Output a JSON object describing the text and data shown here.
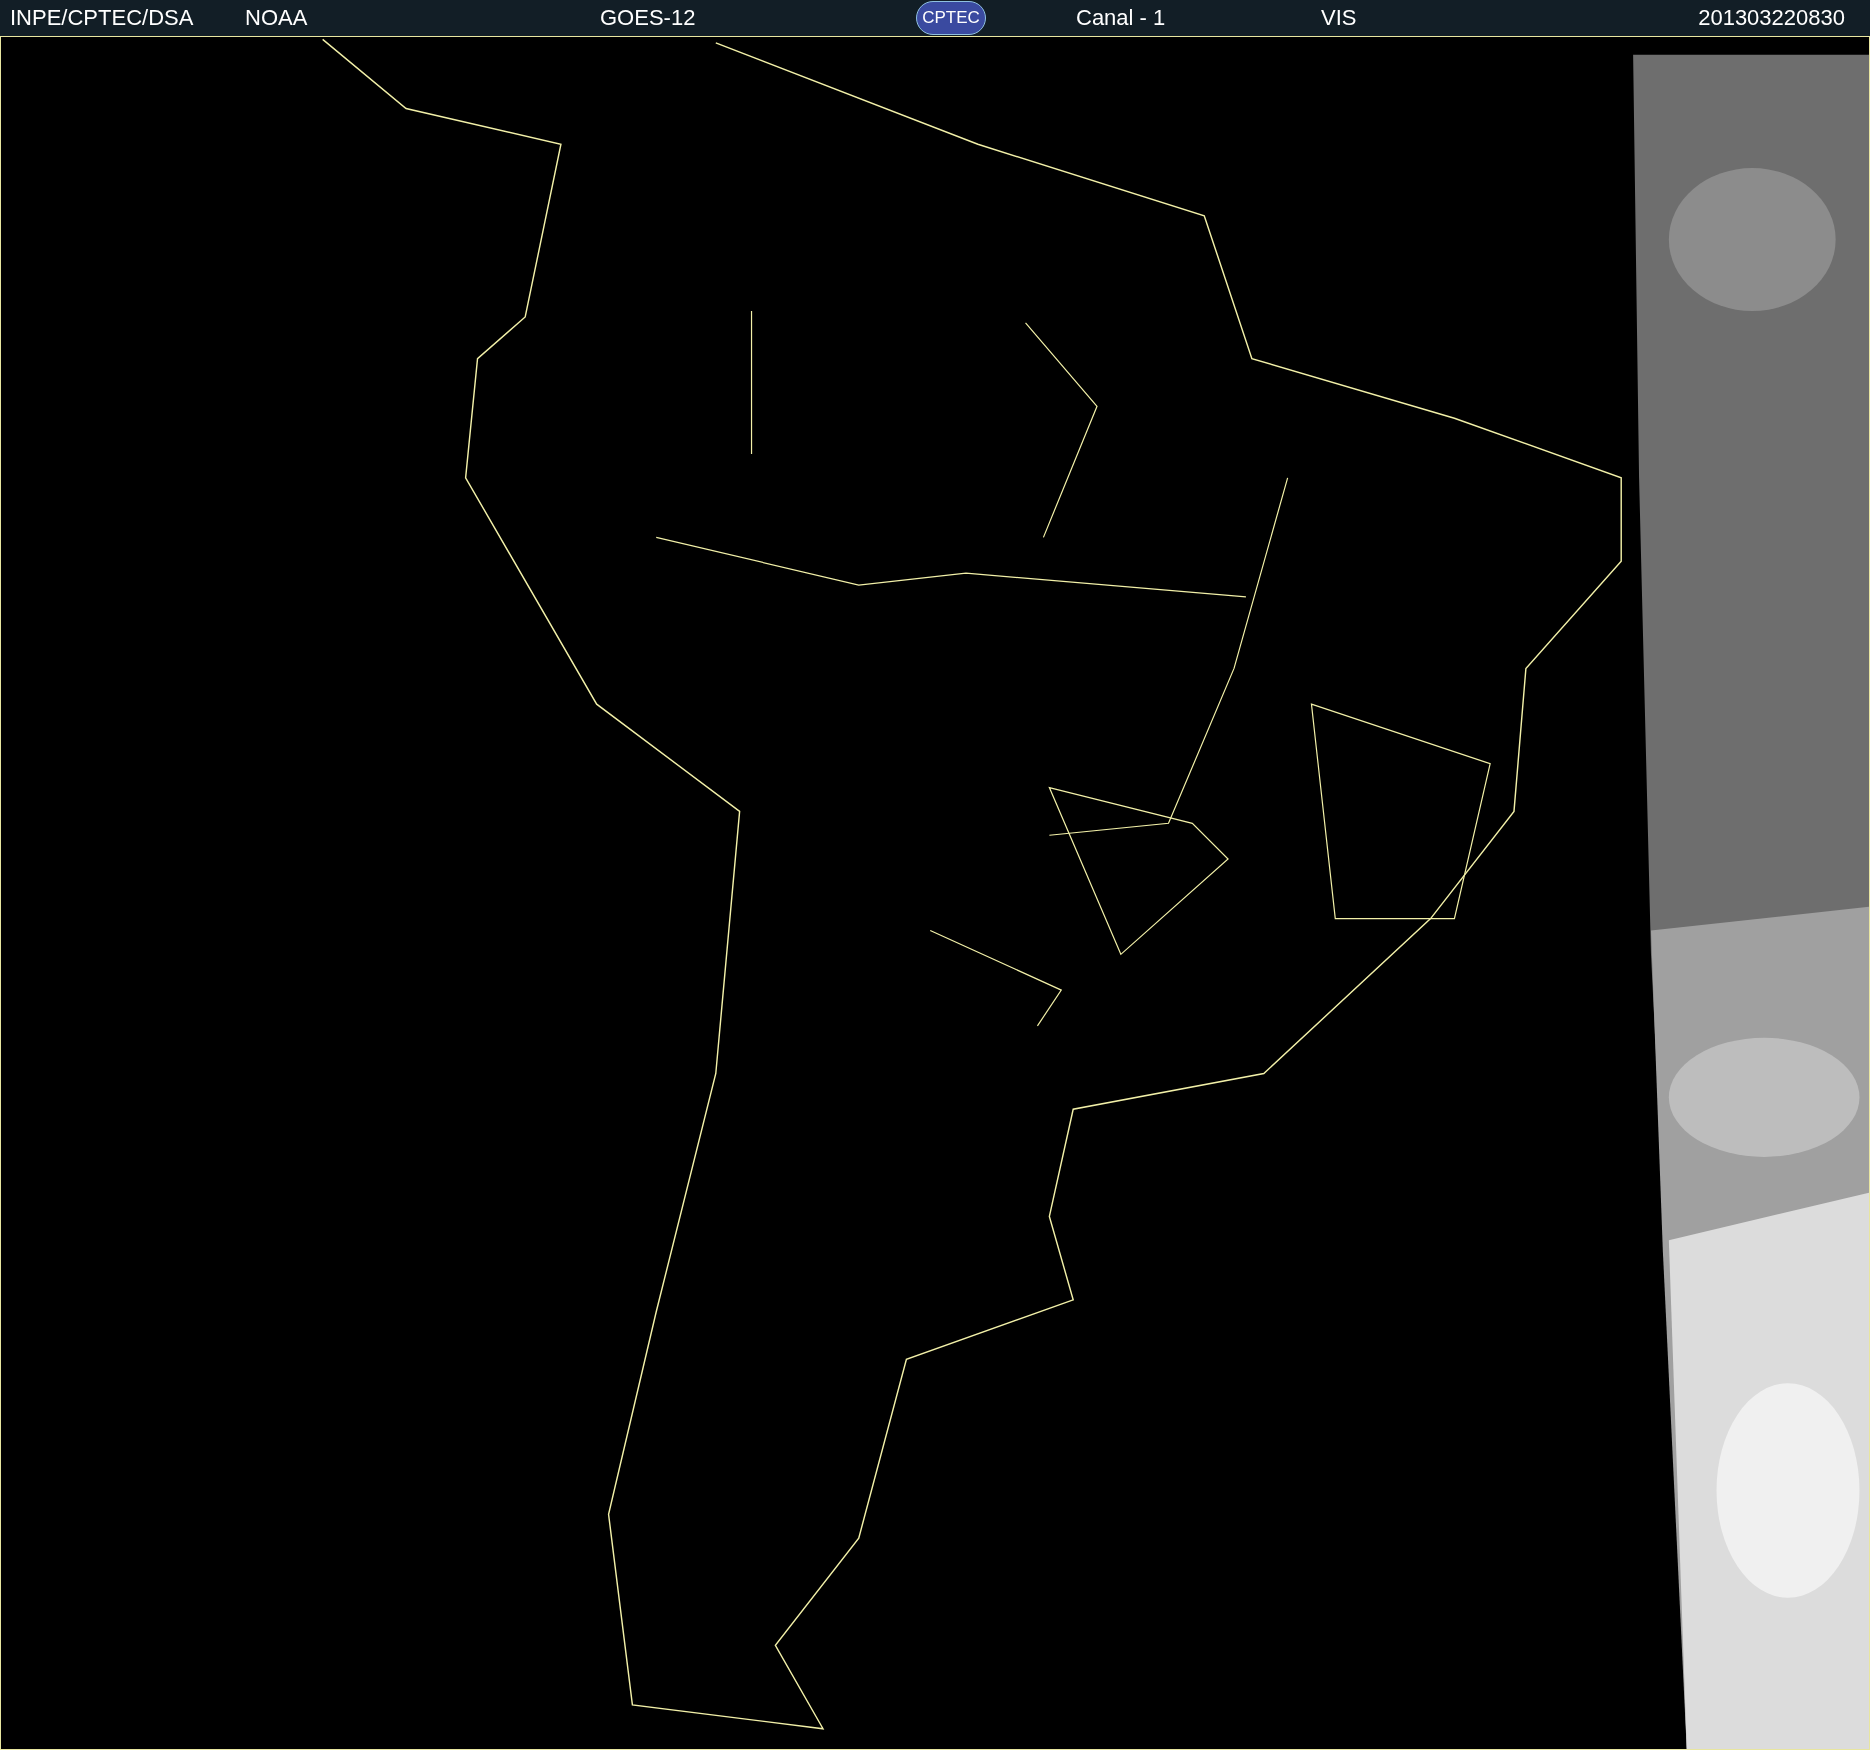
{
  "header": {
    "source": "INPE/CPTEC/DSA",
    "agency": "NOAA",
    "satellite": "GOES-12",
    "logo": "CPTEC",
    "channel": "Canal - 1",
    "band": "VIS",
    "timestamp": "201303220830"
  }
}
